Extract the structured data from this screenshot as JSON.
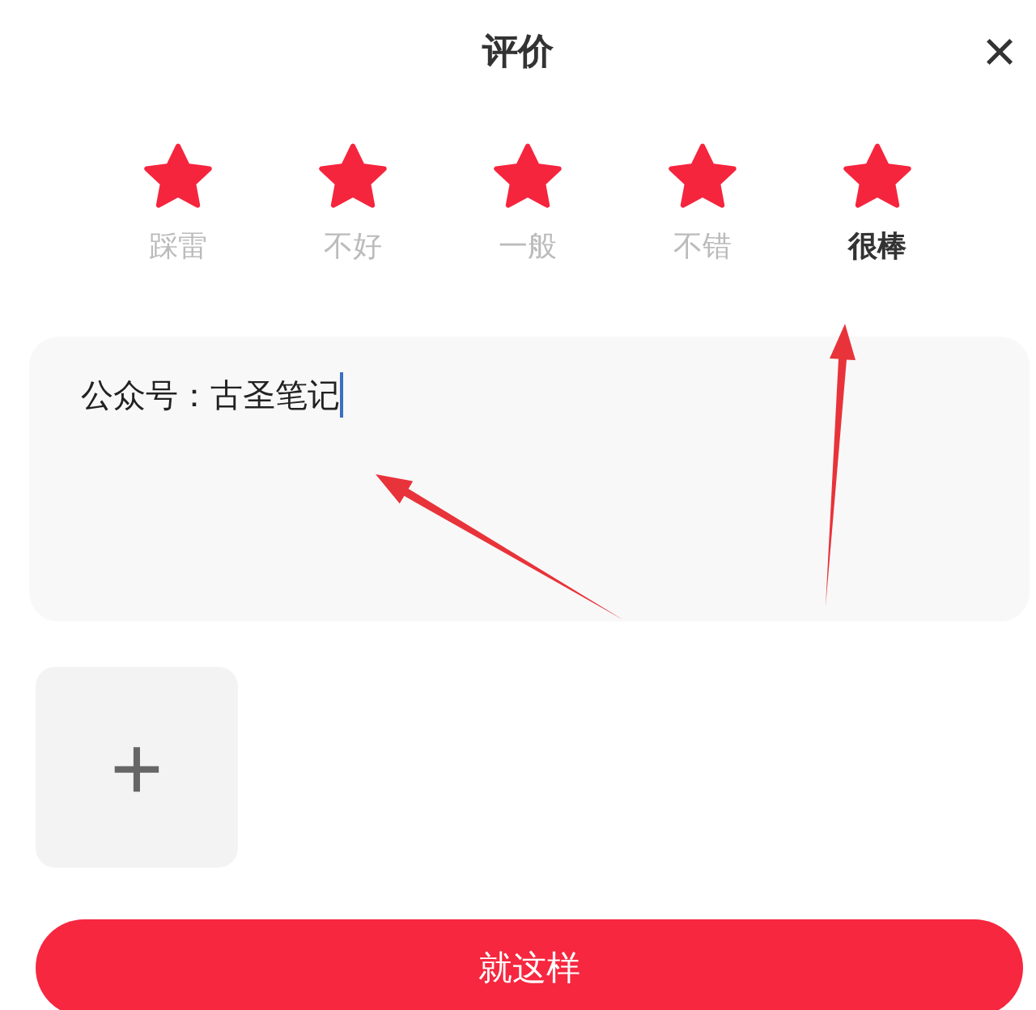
{
  "header": {
    "title": "评价",
    "close": "×"
  },
  "rating": {
    "stars": 5,
    "options": [
      {
        "label": "踩雷",
        "selected": false
      },
      {
        "label": "不好",
        "selected": false
      },
      {
        "label": "一般",
        "selected": false
      },
      {
        "label": "不错",
        "selected": false
      },
      {
        "label": "很棒",
        "selected": true
      }
    ]
  },
  "review": {
    "value": "公众号：古圣笔记"
  },
  "upload": {
    "icon": "+"
  },
  "submit": {
    "label": "就这样"
  }
}
